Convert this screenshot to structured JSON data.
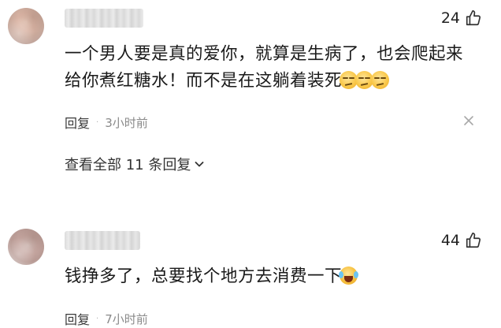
{
  "comments": [
    {
      "likes": "24",
      "text": "一个男人要是真的爱你，就算是生病了，也会爬起来",
      "text_line2": "给你煮红糖水！而不是在这躺着装死",
      "reply_label": "回复",
      "time": "3小时前",
      "view_all": "查看全部 11 条回复"
    },
    {
      "likes": "44",
      "text": "钱挣多了，总要找个地方去消费一下",
      "reply_label": "回复",
      "time": "7小时前"
    }
  ],
  "icons": {
    "like": "thumbs-up-icon",
    "close": "close-icon",
    "expand": "chevron-down-icon",
    "emoji_1": "smirk-emoji-icon",
    "emoji_2": "laugh-cry-emoji-icon"
  },
  "colors": {
    "text": "#1a1a1a",
    "meta": "#8a8a8a",
    "background": "#ffffff"
  }
}
